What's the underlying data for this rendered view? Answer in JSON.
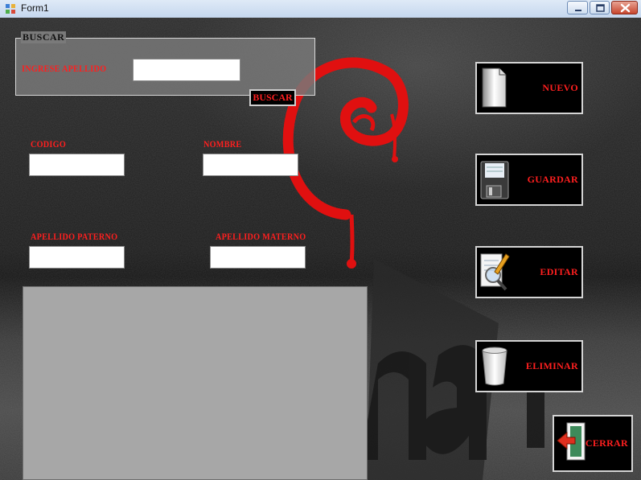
{
  "window": {
    "title": "Form1"
  },
  "search": {
    "group_title": "BUSCAR",
    "label": "INGRESE APELLIDO",
    "input_value": "",
    "button_label": "BUSCAR"
  },
  "form": {
    "codigo_label": "CODIGO",
    "codigo_value": "",
    "nombre_label": "NOMBRE",
    "nombre_value": "",
    "apellido_paterno_label": "APELLIDO PATERNO",
    "apellido_paterno_value": "",
    "apellido_materno_label": "APELLIDO MATERNO",
    "apellido_materno_value": ""
  },
  "actions": {
    "nuevo": "NUEVO",
    "guardar": "GUARDAR",
    "editar": "EDITAR",
    "eliminar": "ELIMINAR",
    "cerrar": "CERRAR"
  },
  "icons": {
    "nuevo": "new-document-icon",
    "guardar": "floppy-disk-icon",
    "editar": "edit-magnifier-icon",
    "eliminar": "trash-bin-icon",
    "cerrar": "exit-door-icon"
  },
  "colors": {
    "label_red": "#ff1f1f",
    "button_bg": "#000000",
    "grid_bg": "#a7a7a7"
  }
}
